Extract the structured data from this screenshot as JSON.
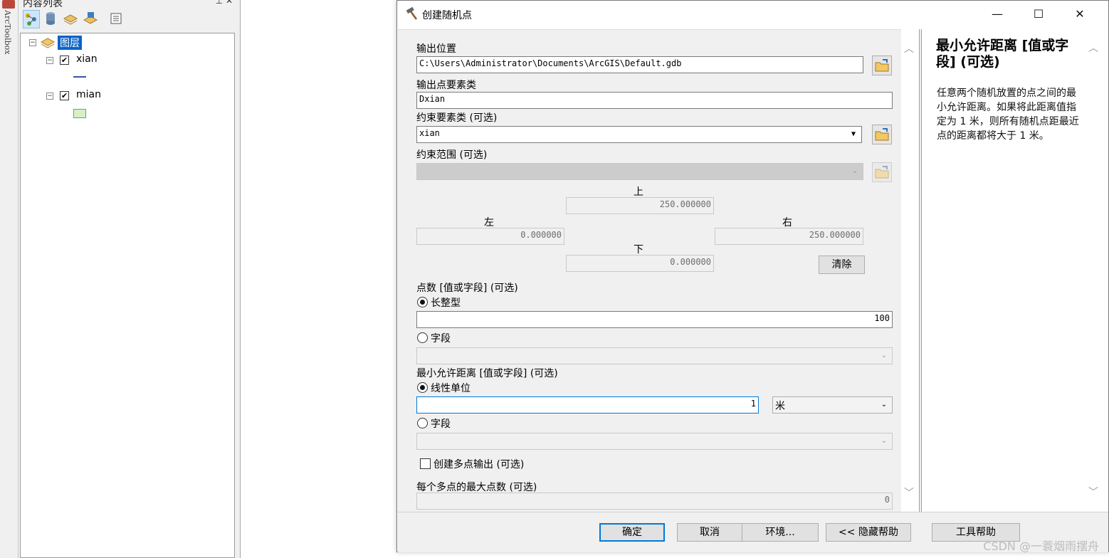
{
  "toolbox_strip": {
    "label": "ArcToolbox"
  },
  "toc": {
    "title": "内容列表",
    "title_buttons": "⊥ ✕",
    "root_label": "图层",
    "layers": [
      {
        "name": "xian",
        "checked": "✔"
      },
      {
        "name": "mian",
        "checked": "✔"
      }
    ]
  },
  "dialog": {
    "title": "创建随机点",
    "window_buttons": {
      "minimize": "—",
      "maximize": "☐",
      "close": "✕"
    },
    "output_location": {
      "label": "输出位置",
      "value": "C:\\Users\\Administrator\\Documents\\ArcGIS\\Default.gdb"
    },
    "output_fc": {
      "label": "输出点要素类",
      "value": "Dxian"
    },
    "constraint_fc": {
      "label": "约束要素类 (可选)",
      "value": "xian"
    },
    "constraint_extent": {
      "label": "约束范围 (可选)",
      "top_label": "上",
      "top_value": "250.000000",
      "left_label": "左",
      "left_value": "0.000000",
      "right_label": "右",
      "right_value": "250.000000",
      "bottom_label": "下",
      "bottom_value": "0.000000",
      "clear_button": "清除"
    },
    "num_points": {
      "label": "点数 [值或字段] (可选)",
      "long_label": "长整型",
      "long_value": "100",
      "field_label": "字段"
    },
    "min_distance": {
      "label": "最小允许距离 [值或字段] (可选)",
      "linear_label": "线性单位",
      "linear_value": "1",
      "unit": "米",
      "field_label": "字段"
    },
    "multipoint": {
      "label": "创建多点输出 (可选)"
    },
    "max_points": {
      "label": "每个多点的最大点数 (可选)",
      "value": "0"
    },
    "help": {
      "title": "最小允许距离 [值或字段] (可选)",
      "text": "任意两个随机放置的点之间的最小允许距离。如果将此距离值指定为 1 米，则所有随机点距最近点的距离都将大于 1 米。"
    },
    "buttons": {
      "ok": "确定",
      "cancel": "取消",
      "env": "环境...",
      "hide_help": "<< 隐藏帮助",
      "tool_help": "工具帮助"
    }
  },
  "watermark": "CSDN @一蓑烟雨摆舟"
}
